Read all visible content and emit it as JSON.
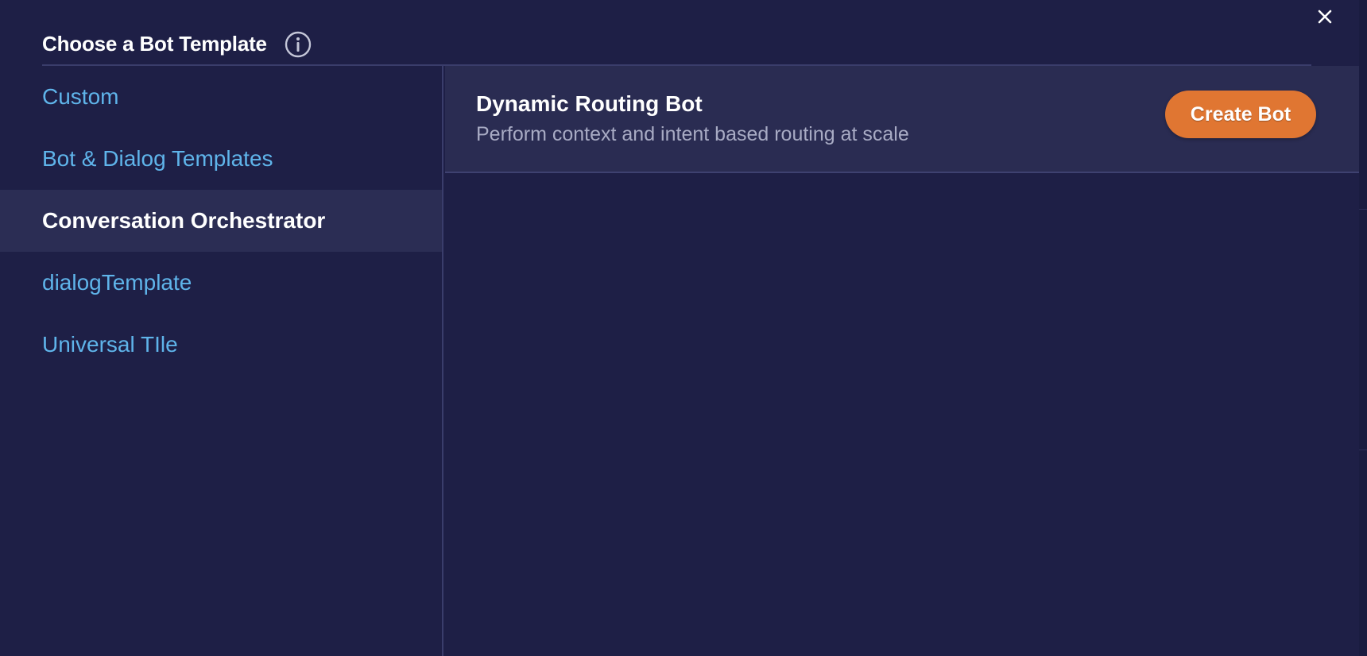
{
  "dialog": {
    "title": "Choose a Bot Template",
    "info_icon": "info-icon",
    "close_icon": "close-icon"
  },
  "sidebar": {
    "items": [
      {
        "label": "Custom",
        "active": false
      },
      {
        "label": "Bot & Dialog Templates",
        "active": false
      },
      {
        "label": "Conversation Orchestrator",
        "active": true
      },
      {
        "label": "dialogTemplate",
        "active": false
      },
      {
        "label": "Universal TIle",
        "active": false
      }
    ]
  },
  "templates": [
    {
      "title": "Dynamic Routing Bot",
      "description": "Perform context and intent based routing at scale",
      "button_label": "Create Bot"
    }
  ],
  "colors": {
    "background": "#1e1f46",
    "active_item_bg": "#2b2d54",
    "link": "#5fb4ea",
    "accent": "#e07632",
    "card_bg": "#2a2c52"
  }
}
